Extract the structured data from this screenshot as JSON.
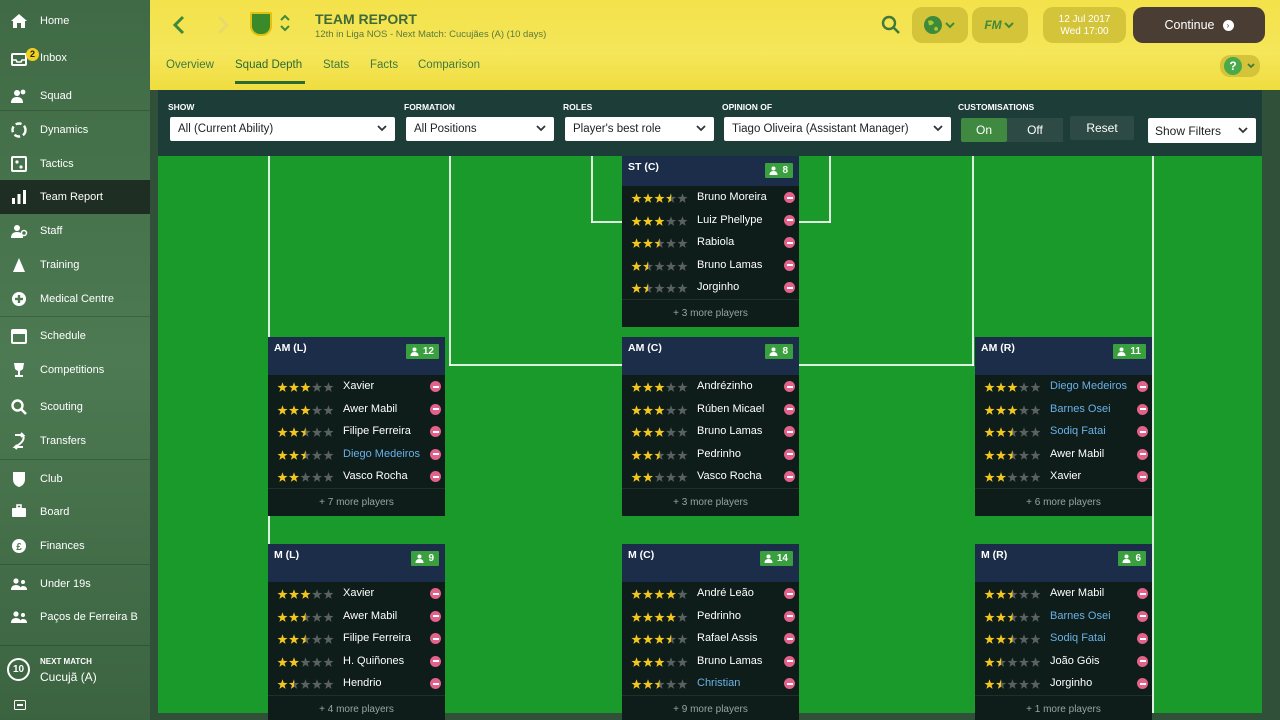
{
  "sidebar": {
    "items": [
      {
        "label": "Home",
        "icon": "home-icon"
      },
      {
        "label": "Inbox",
        "icon": "inbox-icon",
        "badge": "2"
      },
      {
        "label": "Squad",
        "icon": "squad-icon"
      },
      {
        "label": "Dynamics",
        "icon": "dynamics-icon"
      },
      {
        "label": "Tactics",
        "icon": "tactics-icon"
      },
      {
        "label": "Team Report",
        "icon": "team-report-icon",
        "active": true
      },
      {
        "label": "Staff",
        "icon": "staff-icon"
      },
      {
        "label": "Training",
        "icon": "training-icon"
      },
      {
        "label": "Medical Centre",
        "icon": "medical-icon"
      },
      {
        "label": "Schedule",
        "icon": "schedule-icon"
      },
      {
        "label": "Competitions",
        "icon": "trophy-icon"
      },
      {
        "label": "Scouting",
        "icon": "scouting-icon"
      },
      {
        "label": "Transfers",
        "icon": "transfers-icon"
      },
      {
        "label": "Club",
        "icon": "club-icon"
      },
      {
        "label": "Board",
        "icon": "board-icon"
      },
      {
        "label": "Finances",
        "icon": "finances-icon"
      },
      {
        "label": "Under 19s",
        "icon": "under19-icon"
      },
      {
        "label": "Paços de Ferreira B",
        "icon": "reserve-icon"
      }
    ],
    "next_match": {
      "caption": "NEXT MATCH",
      "value": "Cucujã (A)",
      "days": "10"
    }
  },
  "header": {
    "title": "TEAM REPORT",
    "subtitle": "12th in Liga NOS - Next Match: Cucujães (A) (10 days)",
    "date_line1": "12 Jul 2017",
    "date_line2": "Wed 17:00",
    "continue_label": "Continue",
    "fm_label": "FM",
    "help_label": "?"
  },
  "tabs": [
    {
      "label": "Overview"
    },
    {
      "label": "Squad Depth",
      "active": true
    },
    {
      "label": "Stats"
    },
    {
      "label": "Facts"
    },
    {
      "label": "Comparison"
    }
  ],
  "filters": {
    "show": {
      "caption": "SHOW",
      "value": "All (Current Ability)"
    },
    "formation": {
      "caption": "FORMATION",
      "value": "All Positions"
    },
    "roles": {
      "caption": "ROLES",
      "value": "Player's best role"
    },
    "opinion": {
      "caption": "OPINION OF",
      "value": "Tiago Oliveira (Assistant Manager)"
    },
    "customisations": {
      "caption": "CUSTOMISATIONS",
      "on": "On",
      "off": "Off"
    },
    "reset_label": "Reset",
    "show_filters_label": "Show Filters"
  },
  "colors": {
    "header_yellow": "#f5e65a",
    "sidebar_green": "#4d7a52",
    "pitch_green": "#1b9a2c",
    "count_badge": "#3aa03f",
    "star_gold": "#f2c61f",
    "remove_pink": "#e3628a",
    "highlight_blue": "#6ab0e8"
  },
  "positions": [
    {
      "key": "st_c",
      "label": "ST (C)",
      "count": "8",
      "more": "+ 3 more players",
      "players": [
        {
          "name": "Bruno Moreira",
          "stars": 3.5
        },
        {
          "name": "Luiz Phellype",
          "stars": 3
        },
        {
          "name": "Rabiola",
          "stars": 2.5
        },
        {
          "name": "Bruno Lamas",
          "stars": 1.5
        },
        {
          "name": "Jorginho",
          "stars": 1.5
        }
      ]
    },
    {
      "key": "am_l",
      "label": "AM (L)",
      "count": "12",
      "more": "+ 7 more players",
      "players": [
        {
          "name": "Xavier",
          "stars": 3
        },
        {
          "name": "Awer Mabil",
          "stars": 3
        },
        {
          "name": "Filipe Ferreira",
          "stars": 2.5
        },
        {
          "name": "Diego Medeiros",
          "stars": 2.5,
          "highlight": true
        },
        {
          "name": "Vasco Rocha",
          "stars": 2
        }
      ]
    },
    {
      "key": "am_c",
      "label": "AM (C)",
      "count": "8",
      "more": "+ 3 more players",
      "players": [
        {
          "name": "Andrézinho",
          "stars": 3
        },
        {
          "name": "Rúben Micael",
          "stars": 3
        },
        {
          "name": "Bruno Lamas",
          "stars": 3
        },
        {
          "name": "Pedrinho",
          "stars": 2.5
        },
        {
          "name": "Vasco Rocha",
          "stars": 2
        }
      ]
    },
    {
      "key": "am_r",
      "label": "AM (R)",
      "count": "11",
      "more": "+ 6 more players",
      "players": [
        {
          "name": "Diego Medeiros",
          "stars": 3,
          "highlight": true
        },
        {
          "name": "Barnes Osei",
          "stars": 3,
          "highlight": true
        },
        {
          "name": "Sodiq Fatai",
          "stars": 2.5,
          "highlight": true
        },
        {
          "name": "Awer Mabil",
          "stars": 2.5
        },
        {
          "name": "Xavier",
          "stars": 2
        }
      ]
    },
    {
      "key": "m_l",
      "label": "M (L)",
      "count": "9",
      "more": "+ 4 more players",
      "players": [
        {
          "name": "Xavier",
          "stars": 3
        },
        {
          "name": "Awer Mabil",
          "stars": 2.5
        },
        {
          "name": "Filipe Ferreira",
          "stars": 2.5
        },
        {
          "name": "H. Quiñones",
          "stars": 2
        },
        {
          "name": "Hendrio",
          "stars": 1.5
        }
      ]
    },
    {
      "key": "m_c",
      "label": "M (C)",
      "count": "14",
      "more": "+ 9 more players",
      "players": [
        {
          "name": "André Leão",
          "stars": 4
        },
        {
          "name": "Pedrinho",
          "stars": 4
        },
        {
          "name": "Rafael Assis",
          "stars": 3.5
        },
        {
          "name": "Bruno Lamas",
          "stars": 3
        },
        {
          "name": "Christian",
          "stars": 2.5,
          "highlight": true
        }
      ]
    },
    {
      "key": "m_r",
      "label": "M (R)",
      "count": "6",
      "more": "+ 1 more players",
      "players": [
        {
          "name": "Awer Mabil",
          "stars": 2.5
        },
        {
          "name": "Barnes Osei",
          "stars": 2.5,
          "highlight": true
        },
        {
          "name": "Sodiq Fatai",
          "stars": 2.5,
          "highlight": true
        },
        {
          "name": "João Góis",
          "stars": 1.5
        },
        {
          "name": "Jorginho",
          "stars": 1.5
        }
      ]
    }
  ]
}
